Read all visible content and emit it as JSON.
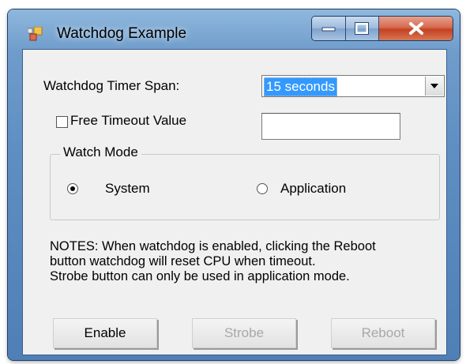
{
  "window": {
    "title": "Watchdog Example"
  },
  "form": {
    "timer_span_label": "Watchdog Timer Span:",
    "timer_span_value": "15 seconds",
    "free_timeout_label": "Free Timeout Value",
    "free_timeout_checked": false,
    "free_timeout_value": ""
  },
  "watch_mode": {
    "legend": "Watch Mode",
    "system_label": "System",
    "application_label": "Application",
    "selected": "System"
  },
  "notes": {
    "line1": "NOTES: When watchdog is enabled, clicking the Reboot",
    "line2": "button watchdog will reset CPU when timeout.",
    "line3": "Strobe button can only be used in application mode."
  },
  "buttons": {
    "enable": "Enable",
    "strobe": "Strobe",
    "reboot": "Reboot"
  }
}
